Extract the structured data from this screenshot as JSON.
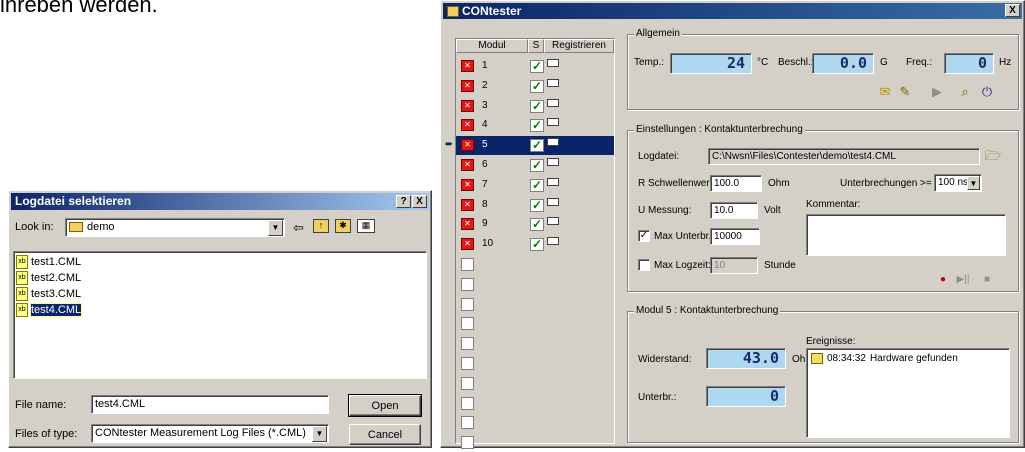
{
  "caption": "inreben werden.",
  "dialog": {
    "title": "Logdatei selektieren",
    "help_label": "?",
    "close_label": "X",
    "look_in_label": "Look in:",
    "look_in_value": "demo",
    "files": [
      {
        "name": "test1.CML",
        "selected": false
      },
      {
        "name": "test2.CML",
        "selected": false
      },
      {
        "name": "test3.CML",
        "selected": false
      },
      {
        "name": "test4.CML",
        "selected": true
      }
    ],
    "file_name_label": "File name:",
    "file_name_value": "test4.CML",
    "files_of_type_label": "Files of type:",
    "files_of_type_value": "CONtester Measurement Log Files (*.CML)",
    "open_label": "Open",
    "cancel_label": "Cancel"
  },
  "main": {
    "title": "CONtester",
    "close_label": "X",
    "modules_header": {
      "modul": "Modul",
      "s": "S",
      "registrieren": "Registrieren"
    },
    "modules": [
      "1",
      "2",
      "3",
      "4",
      "5",
      "6",
      "7",
      "8",
      "9",
      "10"
    ],
    "selected_module": "5",
    "allgemein": {
      "title": "Allgemein",
      "temp_label": "Temp.:",
      "temp_value": "24",
      "temp_unit": "°C",
      "beschl_label": "Beschl.:",
      "beschl_value": "0.0",
      "beschl_unit": "G",
      "freq_label": "Freq.:",
      "freq_value": "0",
      "freq_unit": "Hz"
    },
    "einstellungen": {
      "title": "Einstellungen : Kontaktunterbrechung",
      "logdatei_label": "Logdatei:",
      "logdatei_value": "C:\\Nwsn\\Files\\Contester\\demo\\test4.CML",
      "r_label": "R Schwellenwert:",
      "r_value": "100.0",
      "r_unit": "Ohm",
      "unterbr_label": "Unterbrechungen >=",
      "unterbr_value": "100 ns",
      "u_label": "U Messung:",
      "u_value": "10.0",
      "u_unit": "Volt",
      "kommentar_label": "Kommentar:",
      "max_unterbr_label": "Max Unterbr.:",
      "max_unterbr_value": "10000",
      "max_logzeit_label": "Max Logzeit:",
      "max_logzeit_value": "10",
      "max_logzeit_unit": "Stunde"
    },
    "modul5": {
      "title": "Modul 5 : Kontaktunterbrechung",
      "widerstand_label": "Widerstand:",
      "widerstand_value": "43.0",
      "widerstand_unit": "Ohm",
      "unterbr_label": "Unterbr.:",
      "unterbr_value": "0",
      "ereignisse_label": "Ereignisse:",
      "event_time": "08:34:32",
      "event_text": "Hardware gefunden"
    }
  }
}
